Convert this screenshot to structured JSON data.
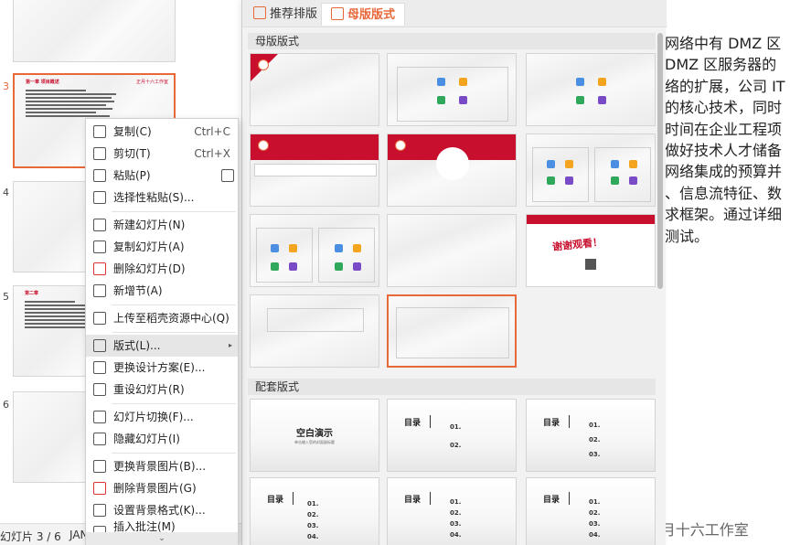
{
  "thumbnails": [
    {
      "number": "3",
      "title": "第一章 项目概述",
      "brand": "正月十六工作室",
      "active": true
    },
    {
      "number": "4",
      "title": "",
      "brand": "",
      "active": false
    },
    {
      "number": "5",
      "title": "第二章",
      "brand": "",
      "active": false
    },
    {
      "number": "6",
      "title": "",
      "brand": "",
      "active": false
    }
  ],
  "status_bar": {
    "slide_info": "幻灯片 3 / 6",
    "theme": "JAN"
  },
  "panel": {
    "tabs": [
      {
        "label": "推荐排版",
        "icon": "thumbs-up-icon"
      },
      {
        "label": "母版版式",
        "icon": "layout-icon"
      }
    ],
    "section_master": "母版版式",
    "section_matching": "配套版式",
    "thanks_text": "谢谢观看！",
    "blank_title": "空白演示",
    "blank_sub": "单击输入您的封面副标题",
    "toc_title": "目录",
    "toc_nums": [
      "01.",
      "02.",
      "03.",
      "04."
    ]
  },
  "context_menu": {
    "items": [
      {
        "label": "复制(C)",
        "shortcut": "Ctrl+C",
        "icon": "copy-icon"
      },
      {
        "label": "剪切(T)",
        "shortcut": "Ctrl+X",
        "icon": "cut-icon"
      },
      {
        "label": "粘贴(P)",
        "shortcut": "",
        "icon": "paste-icon"
      },
      {
        "label": "选择性粘贴(S)...",
        "shortcut": "",
        "icon": "paste-special-icon"
      },
      {
        "label": "新建幻灯片(N)",
        "shortcut": "",
        "icon": "new-slide-icon"
      },
      {
        "label": "复制幻灯片(A)",
        "shortcut": "",
        "icon": "duplicate-slide-icon"
      },
      {
        "label": "删除幻灯片(D)",
        "shortcut": "",
        "icon": "delete-slide-icon"
      },
      {
        "label": "新增节(A)",
        "shortcut": "",
        "icon": "new-section-icon"
      },
      {
        "label": "上传至稻壳资源中心(Q)",
        "shortcut": "",
        "icon": "upload-icon"
      },
      {
        "label": "版式(L)...",
        "shortcut": "",
        "icon": "layout-icon"
      },
      {
        "label": "更换设计方案(E)...",
        "shortcut": "",
        "icon": "design-icon"
      },
      {
        "label": "重设幻灯片(R)",
        "shortcut": "",
        "icon": "reset-icon"
      },
      {
        "label": "幻灯片切换(F)...",
        "shortcut": "",
        "icon": "transition-icon"
      },
      {
        "label": "隐藏幻灯片(I)",
        "shortcut": "",
        "icon": "hide-icon"
      },
      {
        "label": "更换背景图片(B)...",
        "shortcut": "",
        "icon": "change-bg-icon"
      },
      {
        "label": "删除背景图片(G)",
        "shortcut": "",
        "icon": "delete-bg-icon"
      },
      {
        "label": "设置背景格式(K)...",
        "shortcut": "",
        "icon": "bg-format-icon"
      },
      {
        "label": "插入批注(M)",
        "shortcut": "",
        "icon": "comment-icon"
      }
    ]
  },
  "doc_text_lines": [
    "网络中有 DMZ 区",
    " DMZ 区服务器的",
    "络的扩展，公司 IT",
    "的核心技术，同时",
    "时间在企业工程项",
    "做好技术人才储备",
    "网络集成的预算并",
    "、信息流特征、数",
    "求框架。通过详细",
    "测试。"
  ],
  "watermark": "CSDN @正月十六工作室",
  "colors": {
    "accent": "#e8683a",
    "brand_red": "#c8102e"
  }
}
